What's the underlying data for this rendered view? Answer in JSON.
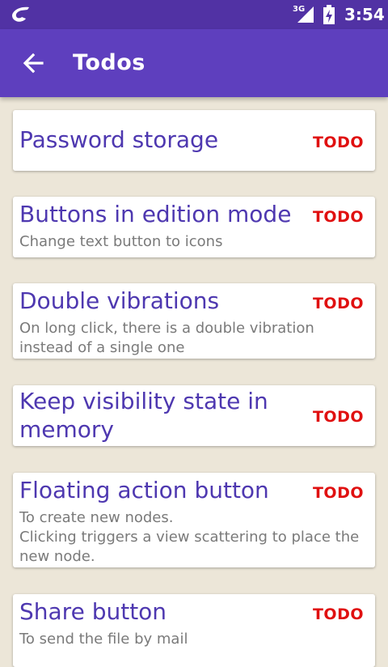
{
  "status_bar": {
    "network": "3G",
    "time": "3:54"
  },
  "header": {
    "title": "Todos"
  },
  "todos": [
    {
      "title": "Password storage",
      "description": "",
      "status": "TODO"
    },
    {
      "title": "Buttons in edition mode",
      "description": "Change text button to icons",
      "status": "TODO"
    },
    {
      "title": "Double vibrations",
      "description": "On long click, there is a double vibration\ninstead of a single one",
      "status": "TODO"
    },
    {
      "title": "Keep visibility state in\nmemory",
      "description": "",
      "status": "TODO"
    },
    {
      "title": "Floating action button",
      "description": "To create new nodes.\nClicking triggers a view scattering to place the\nnew node.",
      "status": "TODO"
    },
    {
      "title": "Share button",
      "description": "To send the file by mail",
      "status": "TODO"
    }
  ],
  "colors": {
    "status_bar": "#5132A4",
    "app_bar": "#5E3FBE",
    "background": "#ECE6D8",
    "title_text": "#4E38B0",
    "status_text": "#E01010"
  }
}
